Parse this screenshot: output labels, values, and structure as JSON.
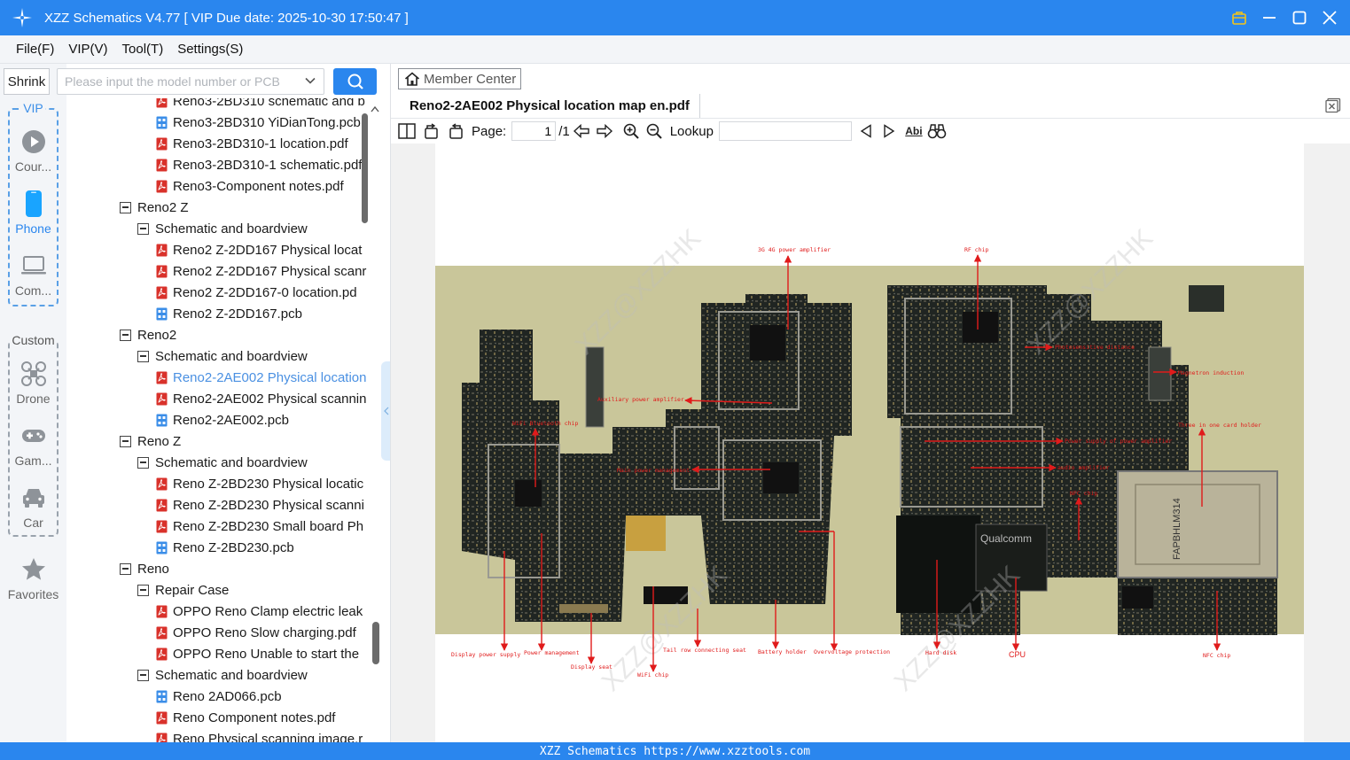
{
  "app": {
    "title": "XZZ Schematics V4.77 [ VIP Due date: 2025-10-30 17:50:47 ]"
  },
  "menu": [
    "File(F)",
    "VIP(V)",
    "Tool(T)",
    "Settings(S)"
  ],
  "sidebar": {
    "shrink_label": "Shrink",
    "vip_label": "VIP",
    "custom_label": "Custom",
    "vip_items": [
      {
        "label": "Cour...",
        "icon": "play-circle-icon"
      },
      {
        "label": "Phone",
        "icon": "phone-icon"
      },
      {
        "label": "Com...",
        "icon": "laptop-icon"
      }
    ],
    "custom_items": [
      {
        "label": "Drone",
        "icon": "drone-icon"
      },
      {
        "label": "Gam...",
        "icon": "gamepad-icon"
      },
      {
        "label": "Car",
        "icon": "car-icon"
      }
    ],
    "favorites_label": "Favorites"
  },
  "search": {
    "placeholder": "Please input the model number or PCB"
  },
  "tree": [
    {
      "level": 2,
      "type": "pdf",
      "label": "Reno3-2BD310 schematic and b"
    },
    {
      "level": 2,
      "type": "pcb",
      "label": "Reno3-2BD310 YiDianTong.pcb"
    },
    {
      "level": 2,
      "type": "pdf",
      "label": "Reno3-2BD310-1 location.pdf"
    },
    {
      "level": 2,
      "type": "pdf",
      "label": "Reno3-2BD310-1 schematic.pdf"
    },
    {
      "level": 2,
      "type": "pdf",
      "label": "Reno3-Component notes.pdf"
    },
    {
      "level": 0,
      "type": "folder",
      "label": "Reno2 Z"
    },
    {
      "level": 1,
      "type": "folder",
      "label": "Schematic and boardview"
    },
    {
      "level": 2,
      "type": "pdf",
      "label": "Reno2 Z-2DD167 Physical locat"
    },
    {
      "level": 2,
      "type": "pdf",
      "label": "Reno2 Z-2DD167 Physical scanr"
    },
    {
      "level": 2,
      "type": "pdf",
      "label": "Reno2 Z-2DD167-0 location.pd"
    },
    {
      "level": 2,
      "type": "pcb",
      "label": "Reno2 Z-2DD167.pcb"
    },
    {
      "level": 0,
      "type": "folder",
      "label": "Reno2"
    },
    {
      "level": 1,
      "type": "folder",
      "label": "Schematic and boardview"
    },
    {
      "level": 2,
      "type": "pdf",
      "label": "Reno2-2AE002 Physical location",
      "selected": true
    },
    {
      "level": 2,
      "type": "pdf",
      "label": "Reno2-2AE002 Physical scannin"
    },
    {
      "level": 2,
      "type": "pcb",
      "label": "Reno2-2AE002.pcb"
    },
    {
      "level": 0,
      "type": "folder",
      "label": "Reno Z"
    },
    {
      "level": 1,
      "type": "folder",
      "label": "Schematic and boardview"
    },
    {
      "level": 2,
      "type": "pdf",
      "label": "Reno Z-2BD230 Physical locatic"
    },
    {
      "level": 2,
      "type": "pdf",
      "label": "Reno Z-2BD230 Physical scanni"
    },
    {
      "level": 2,
      "type": "pdf",
      "label": "Reno Z-2BD230 Small board Ph"
    },
    {
      "level": 2,
      "type": "pcb",
      "label": "Reno Z-2BD230.pcb"
    },
    {
      "level": 0,
      "type": "folder",
      "label": "Reno"
    },
    {
      "level": 1,
      "type": "folder",
      "label": "Repair Case"
    },
    {
      "level": 2,
      "type": "pdf",
      "label": "OPPO Reno Clamp electric leak"
    },
    {
      "level": 2,
      "type": "pdf",
      "label": "OPPO Reno Slow charging.pdf"
    },
    {
      "level": 2,
      "type": "pdf",
      "label": "OPPO Reno Unable to start the"
    },
    {
      "level": 1,
      "type": "folder",
      "label": "Schematic and boardview"
    },
    {
      "level": 2,
      "type": "pcb",
      "label": "Reno 2AD066.pcb"
    },
    {
      "level": 2,
      "type": "pdf",
      "label": "Reno Component notes.pdf"
    },
    {
      "level": 2,
      "type": "pdf",
      "label": "Reno Physical scanning image.r"
    }
  ],
  "viewer": {
    "member_center": "Member Center",
    "doc_tab": "Reno2-2AE002 Physical location map en.pdf",
    "page_label": "Page:",
    "page_value": "1",
    "page_total": "/1",
    "lookup_label": "Lookup",
    "lookup_value": "",
    "text_icon_label": "Abi"
  },
  "document": {
    "watermark": "XZZ@XZZHK",
    "annotations": {
      "top_left": [
        "3G 4G power amplifier",
        "Auxiliary power amplifier",
        "WiFi Bluetooth chip",
        "Main power management"
      ],
      "top_right": [
        "RF chip",
        "Photosensitive distance",
        "Magnetron induction",
        "Power supply of power amplifier",
        "Three in one card holder",
        "audio amplifier",
        "NFC chip"
      ],
      "bottom": [
        "Display power supply",
        "Power management",
        "Display seat",
        "WiFi chip",
        "Tail row connecting seat",
        "Battery holder",
        "Overvoltage protection",
        "Hard disk",
        "CPU",
        "NFC chip"
      ]
    },
    "chip_text": [
      "Qualcomm",
      "FAPBHLM314"
    ]
  },
  "status": {
    "text": "XZZ Schematics https://www.xzztools.com"
  },
  "colors": {
    "accent": "#2a86ee",
    "annotation": "#e01b1b",
    "selected_text": "#4a90e2"
  }
}
